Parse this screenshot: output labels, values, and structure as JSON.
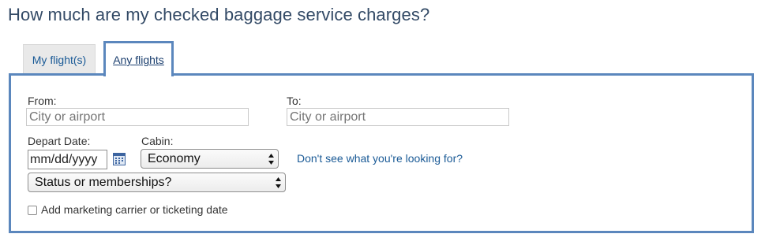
{
  "page": {
    "title": "How much are my checked baggage service charges?"
  },
  "tabs": [
    {
      "label": "My flight(s)",
      "active": false
    },
    {
      "label": "Any flights",
      "active": true
    }
  ],
  "form": {
    "from": {
      "label": "From:",
      "placeholder": "City or airport"
    },
    "to": {
      "label": "To:",
      "placeholder": "City or airport"
    },
    "depart_date": {
      "label": "Depart Date:",
      "value": "mm/dd/yyyy"
    },
    "cabin": {
      "label": "Cabin:",
      "selected": "Economy"
    },
    "status": {
      "selected": "Status or memberships?"
    },
    "help_link": "Don't see what you're looking for?",
    "marketing_checkbox": {
      "label": "Add marketing carrier or ticketing date",
      "checked": false
    }
  },
  "colors": {
    "accent": "#5b87bd",
    "link": "#1a5a96",
    "title": "#334a66"
  },
  "icons": {
    "calendar": "calendar-icon",
    "select_arrows": "chevron-updown-icon"
  }
}
